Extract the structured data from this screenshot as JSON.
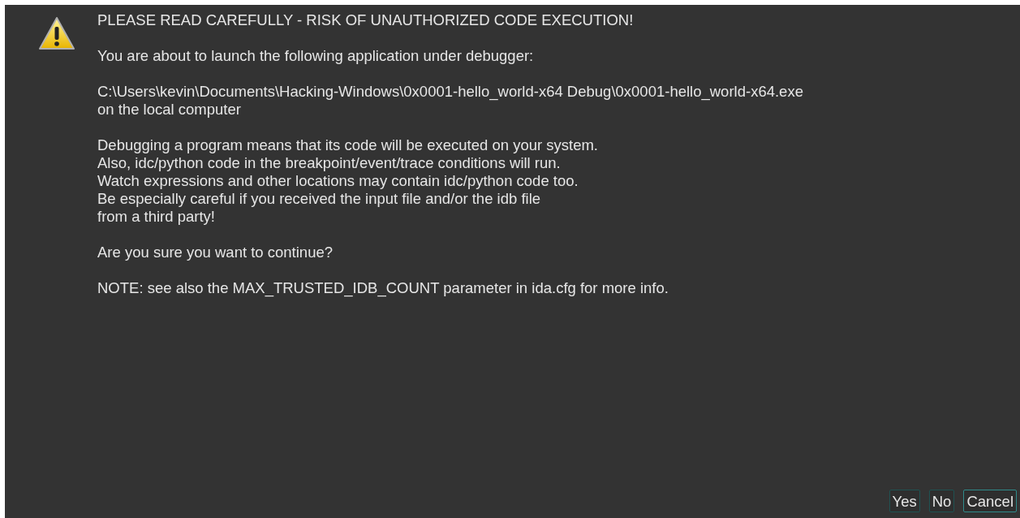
{
  "dialog": {
    "heading": "PLEASE READ CAREFULLY - RISK OF UNAUTHORIZED CODE EXECUTION!",
    "paragraphs": [
      {
        "lines": [
          "You are about to launch the following application under debugger:"
        ]
      },
      {
        "lines": [
          "C:\\Users\\kevin\\Documents\\Hacking-Windows\\0x0001-hello_world-x64 Debug\\0x0001-hello_world-x64.exe",
          "on the local computer"
        ]
      },
      {
        "lines": [
          "Debugging a program means that its code will be executed on your system.",
          "Also, idc/python code in the breakpoint/event/trace conditions will run.",
          "Watch expressions and other locations may contain idc/python code too.",
          "Be especially careful if you received the input file and/or the idb file",
          "from a third party!"
        ]
      },
      {
        "lines": [
          "Are you sure you want to continue?"
        ]
      },
      {
        "lines": [
          "NOTE: see also the MAX_TRUSTED_IDB_COUNT parameter in ida.cfg for more info."
        ]
      }
    ],
    "buttons": [
      {
        "label": "Yes",
        "default": false
      },
      {
        "label": "No",
        "default": false
      },
      {
        "label": "Cancel",
        "default": true
      }
    ]
  }
}
